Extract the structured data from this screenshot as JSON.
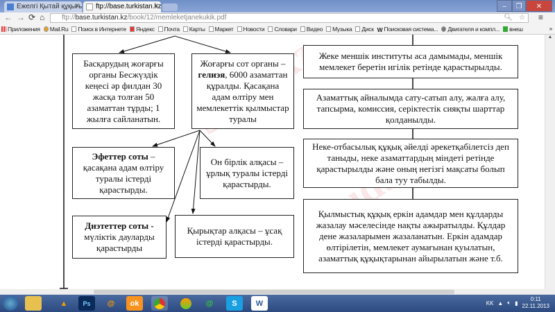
{
  "browser": {
    "tabs": [
      {
        "label": "Ежелгі Қытай құқығы - Р"
      },
      {
        "label": "ftp://base.turkistan.kz/bo"
      }
    ],
    "url_prefix": "ftp://",
    "url_host": "base.turkistan.kz",
    "url_path": "/book/12/memleketjanekukik.pdf",
    "bookmarks": [
      "Приложения",
      "Mail.Ru",
      "Поиск в Интернете",
      "Яндекс",
      "Почта",
      "Карты",
      "Маркет",
      "Новости",
      "Словари",
      "Видео",
      "Музыка",
      "Диск",
      "Поисковая система...",
      "Двигателя и компл...",
      "внеш"
    ],
    "bookmarks_more": "»"
  },
  "document": {
    "left": {
      "box1": "Басқарудың жоғарғы органы Бесжүздік кеңесі әр филдан 30 жасқа толған 50 азаматтан тұрды; 1 жылға сайланатын.",
      "box2_pre": "Жоғарғы сот органы –",
      "box2_bold": "гелиэя",
      "box2_post": ", 6000 азаматтан құралды. Қасақана адам өлтіру мен мемлекеттік қылмыстар туралы",
      "box3_bold": "Эфеттер  соты",
      "box3_post": " – қасақана адам өлтіру туралы істерді қарастырды.",
      "box4": "Он бірлік алқасы – ұрлық туралы істерді қарастырды.",
      "box5_bold": "Диэтеттер соты -",
      "box5_post": " мүліктік дауларды қарастырды",
      "box6": "Қырықтар алқасы – ұсақ істерді қарастырды."
    },
    "right": [
      "Жеке меншік институты аса дамымады, меншік мемлекет беретін игілік ретінде қарастырылды.",
      "Азаматтық айналымда сату-сатып алу, жалға алу, тапсырма, комиссия, серіктестік сияқты шарттар қолданылды.",
      "Неке-отбасылық құқық әйелді әрекетқабілетсіз деп таныды, неке азаматтардың міндеті ретінде қарастырылды және оның негізгі мақсаты болып бала туу табылды.",
      "Қылмыстық құқық еркін адамдар мен құлдарды жазалау мәселесінде нақты ажыратылды. Құлдар дене жазаларымен жазаланатын. Еркін адамдар өлтірілетін, мемлекет аумағынан қуылатын, азаматтық құқықтарынан айырылатын және т.б."
    ]
  },
  "taskbar": {
    "apps": [
      "start",
      "explorer",
      "aimp",
      "photoshop",
      "mail-agent",
      "odnoklassniki",
      "chrome",
      "app-green",
      "mail-agent-2",
      "skype",
      "word"
    ],
    "lang": "KK",
    "time": "0:11",
    "date": "22.11.2013"
  }
}
